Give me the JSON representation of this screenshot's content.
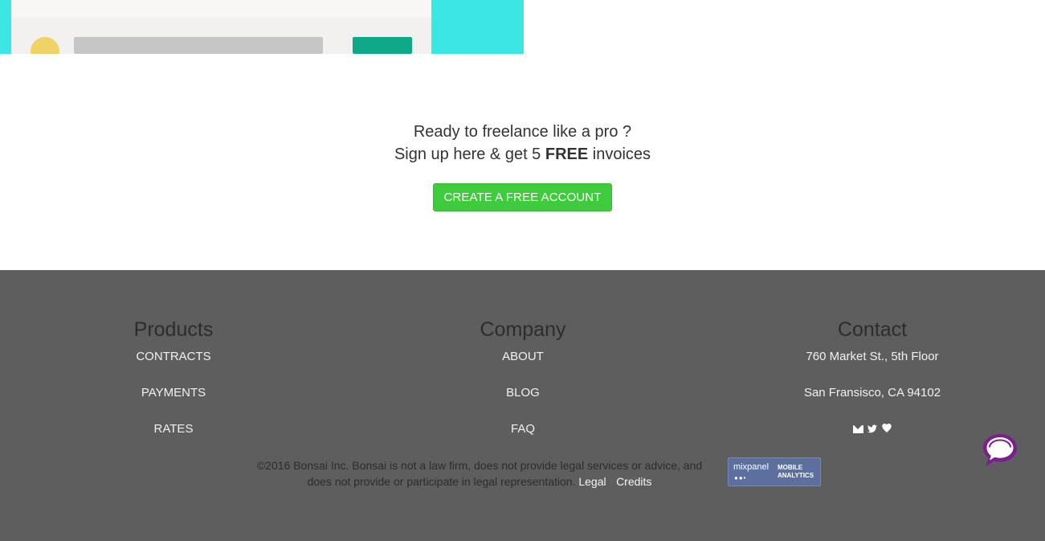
{
  "cta": {
    "line1": "Ready to freelance like a pro ?",
    "line2_prefix": "Sign up here & get 5",
    "line2_bold": "FREE",
    "line2_suffix": "invoices",
    "button_label": "CREATE A FREE ACCOUNT"
  },
  "footer": {
    "products": {
      "heading": "Products",
      "links": [
        "CONTRACTS",
        "PAYMENTS",
        "RATES"
      ]
    },
    "company": {
      "heading": "Company",
      "links": [
        "ABOUT",
        "BLOG",
        "FAQ"
      ]
    },
    "contact": {
      "heading": "Contact",
      "address_line1": "760 Market St., 5th Floor",
      "address_line2": "San Fransisco, CA 94102",
      "icons": [
        "envelope-icon",
        "twitter-icon",
        "heart-icon"
      ]
    },
    "legal": {
      "text": "©2016 Bonsai Inc. Bonsai is not a law firm, does not provide legal services or advice, and does not provide or participate in legal representation.",
      "legal_link": "Legal",
      "separator": "·",
      "credits_link": "Credits"
    },
    "badge": {
      "brand": "mixpanel",
      "tag_line1": "MOBILE",
      "tag_line2": "ANALYTICS"
    }
  },
  "colors": {
    "accent_teal": "#3ce6e2",
    "cta_green": "#3ecb3c",
    "footer_bg": "#5e5e5e",
    "chat_purple": "#7a1f8c"
  }
}
